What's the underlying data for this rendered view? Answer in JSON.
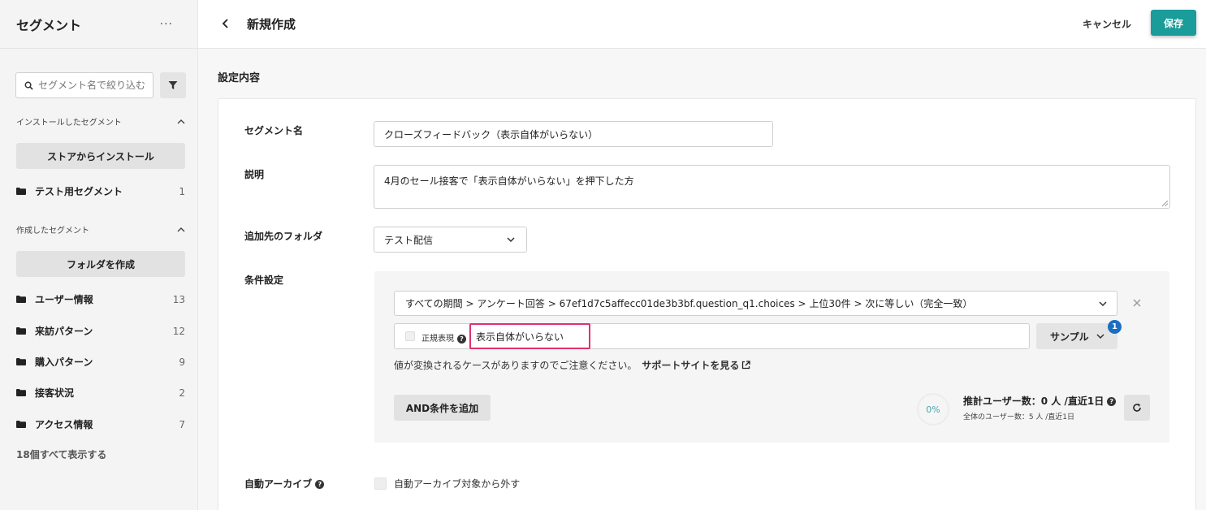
{
  "sidebar": {
    "title": "セグメント",
    "more": "···",
    "search_placeholder": "セグメント名で絞り込む",
    "installed_section": "インストールしたセグメント",
    "store_install_button": "ストアからインストール",
    "installed_items": [
      {
        "label": "テスト用セグメント",
        "count": "1"
      }
    ],
    "created_section": "作成したセグメント",
    "create_folder_button": "フォルダを作成",
    "created_items": [
      {
        "label": "ユーザー情報",
        "count": "13"
      },
      {
        "label": "来訪パターン",
        "count": "12"
      },
      {
        "label": "購入パターン",
        "count": "9"
      },
      {
        "label": "接客状況",
        "count": "2"
      },
      {
        "label": "アクセス情報",
        "count": "7"
      }
    ],
    "show_all": "18個すべて表示する"
  },
  "header": {
    "title": "新規作成",
    "cancel": "キャンセル",
    "save": "保存",
    "save_color": "#199c9a"
  },
  "main": {
    "section_title": "設定内容",
    "name_label": "セグメント名",
    "name_value": "クローズフィードバック（表示自体がいらない）",
    "desc_label": "説明",
    "desc_value": "4月のセール接客で「表示自体がいらない」を押下した方",
    "folder_label": "追加先のフォルダ",
    "folder_value": "テスト配信",
    "cond_label": "条件設定",
    "condition": {
      "select_value": "すべての期間 > アンケート回答 > 67ef1d7c5affecc01de3b3bf.question_q1.choices > 上位30件 > 次に等しい（完全一致）",
      "regex_label": "正規表現",
      "value": "表示自体がいらない",
      "sample_button": "サンプル",
      "sample_badge": "1",
      "note": "値が変換されるケースがありますのでご注意ください。",
      "support_link": "サポートサイトを見る",
      "and_button": "AND条件を追加",
      "percent": "0%",
      "estimate": "推計ユーザー数：0 人 /直近1日",
      "total": "全体のユーザー数：5 人 /直近1日"
    },
    "auto_archive_label": "自動アーカイブ",
    "auto_archive_option": "自動アーカイブ対象から外す"
  }
}
